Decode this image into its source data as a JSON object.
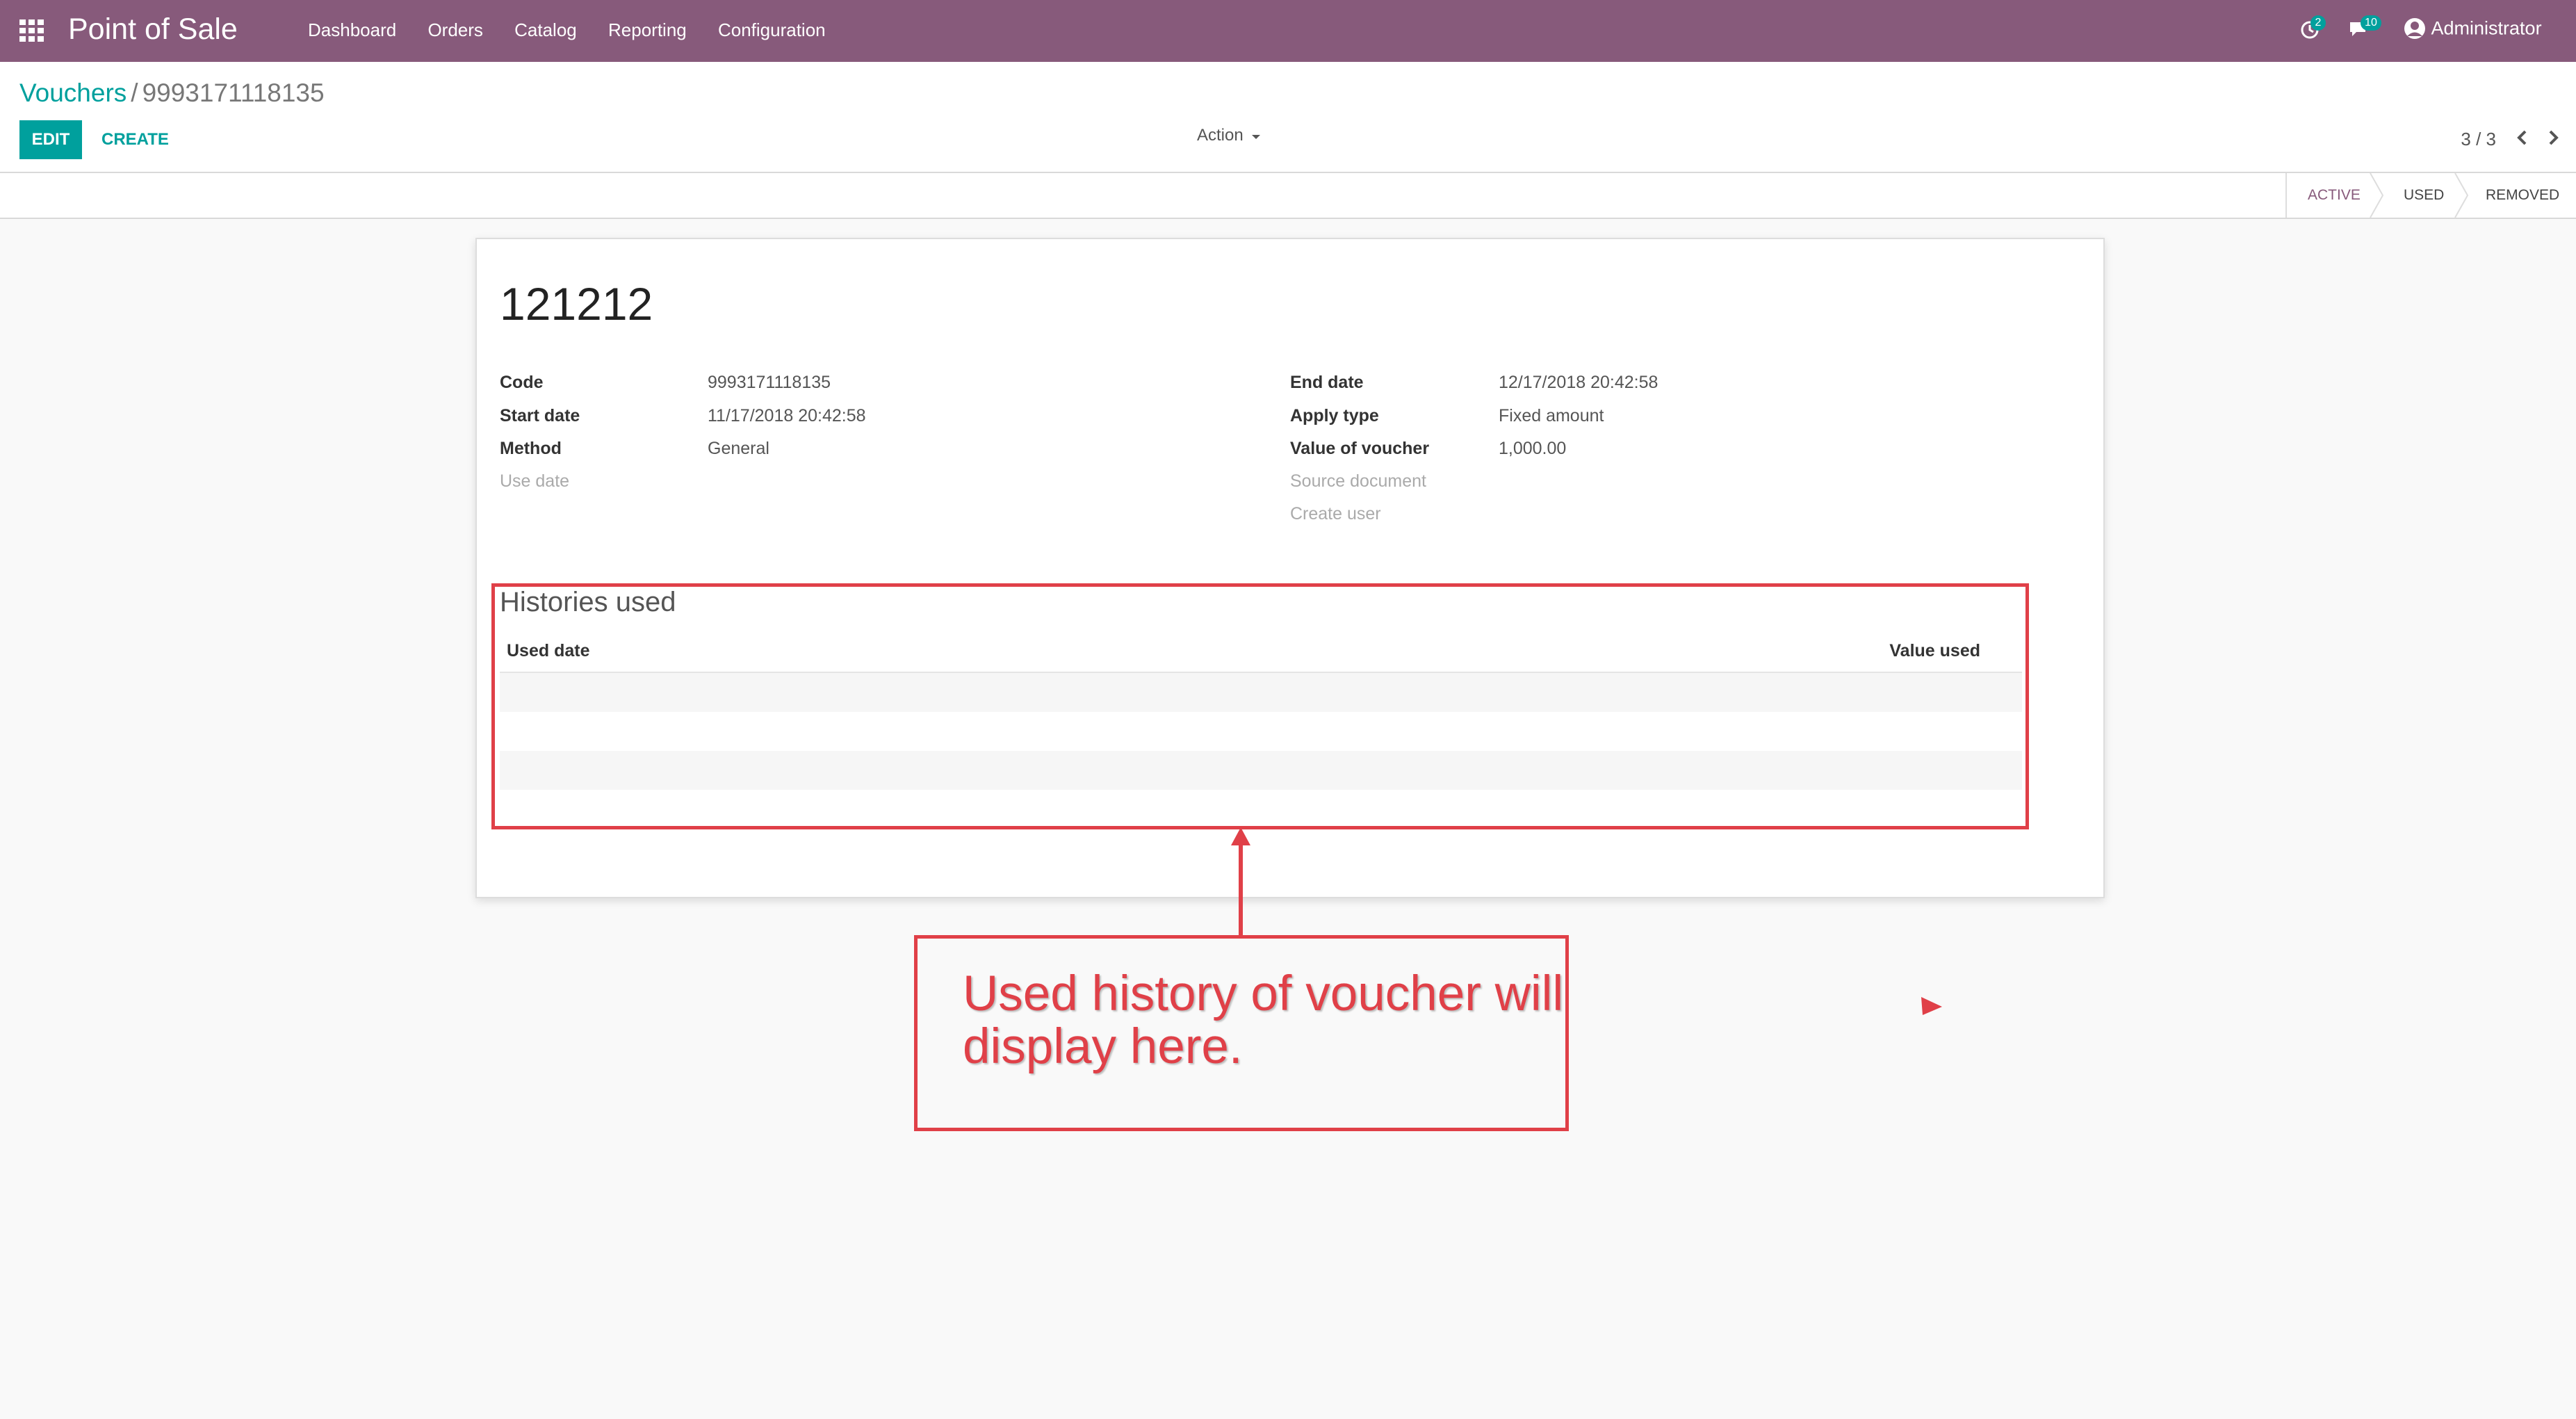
{
  "navbar": {
    "brand": "Point of Sale",
    "menu": [
      "Dashboard",
      "Orders",
      "Catalog",
      "Reporting",
      "Configuration"
    ],
    "activity_count": "2",
    "messages_count": "10",
    "user": "Administrator"
  },
  "control": {
    "breadcrumb_parent": "Vouchers",
    "breadcrumb_separator": "/",
    "breadcrumb_current": "9993171118135",
    "edit_label": "EDIT",
    "create_label": "CREATE",
    "action_label": "Action",
    "pager": "3 / 3"
  },
  "statusbar": {
    "stages": [
      "ACTIVE",
      "USED",
      "REMOVED"
    ],
    "current": "ACTIVE"
  },
  "form": {
    "name": "121212",
    "left_fields": [
      {
        "label": "Code",
        "value": "9993171118135"
      },
      {
        "label": "Start date",
        "value": "11/17/2018 20:42:58"
      },
      {
        "label": "Method",
        "value": "General"
      },
      {
        "label": "Use date",
        "value": ""
      }
    ],
    "right_fields": [
      {
        "label": "End date",
        "value": "12/17/2018 20:42:58"
      },
      {
        "label": "Apply type",
        "value": "Fixed amount"
      },
      {
        "label": "Value of voucher",
        "value": "1,000.00"
      },
      {
        "label": "Source document",
        "value": ""
      },
      {
        "label": "Create user",
        "value": ""
      }
    ],
    "histories": {
      "title": "Histories used",
      "columns": [
        "Used date",
        "Value used"
      ],
      "rows": []
    }
  },
  "annotation": {
    "text_line1": "Used history of voucher will",
    "text_line2": "display here.",
    "color": "#e04048"
  },
  "colors": {
    "brand": "#875a7b",
    "accent": "#00a09d"
  }
}
